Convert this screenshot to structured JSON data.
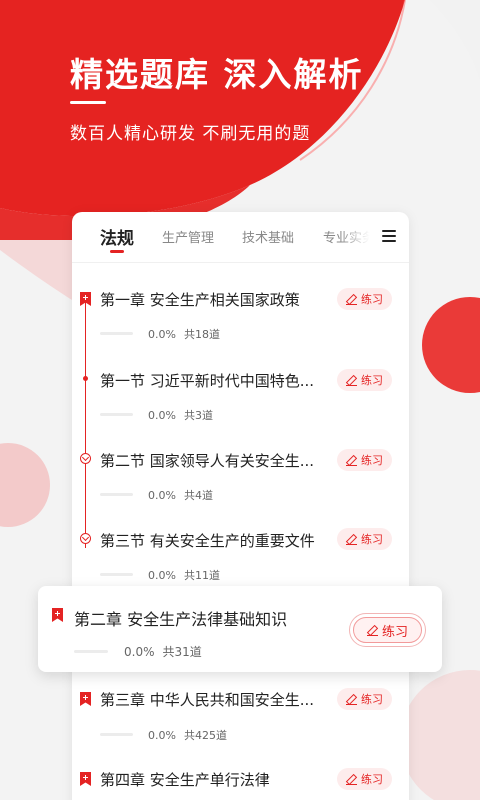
{
  "hero": {
    "title": "精选题库  深入解析",
    "subtitle": "数百人精心研发  不刷无用的题"
  },
  "colors": {
    "accent": "#e42323",
    "background": "#f3f3f3",
    "button_bg": "#fdecec"
  },
  "tabs": [
    {
      "label": "法规",
      "active": true
    },
    {
      "label": "生产管理",
      "active": false
    },
    {
      "label": "技术基础",
      "active": false
    },
    {
      "label": "专业实务",
      "active": false
    }
  ],
  "practice_label": "练习",
  "items": [
    {
      "title": "第一章  安全生产相关国家政策",
      "progress": "0.0%",
      "total": "共18道"
    },
    {
      "title": "第一节  习近平新时代中国特色...",
      "progress": "0.0%",
      "total": "共3道"
    },
    {
      "title": "第二节  国家领导人有关安全生...",
      "progress": "0.0%",
      "total": "共4道"
    },
    {
      "title": "第三节  有关安全生产的重要文件",
      "progress": "0.0%",
      "total": "共11道"
    },
    {
      "title": "第二章   安全生产法律基础知识",
      "progress": "0.0%",
      "total": "共31道"
    },
    {
      "title": "第三章   中华人民共和国安全生...",
      "progress": "0.0%",
      "total": "共425道"
    },
    {
      "title": "第四章   安全生产单行法律",
      "progress": "",
      "total": ""
    }
  ]
}
